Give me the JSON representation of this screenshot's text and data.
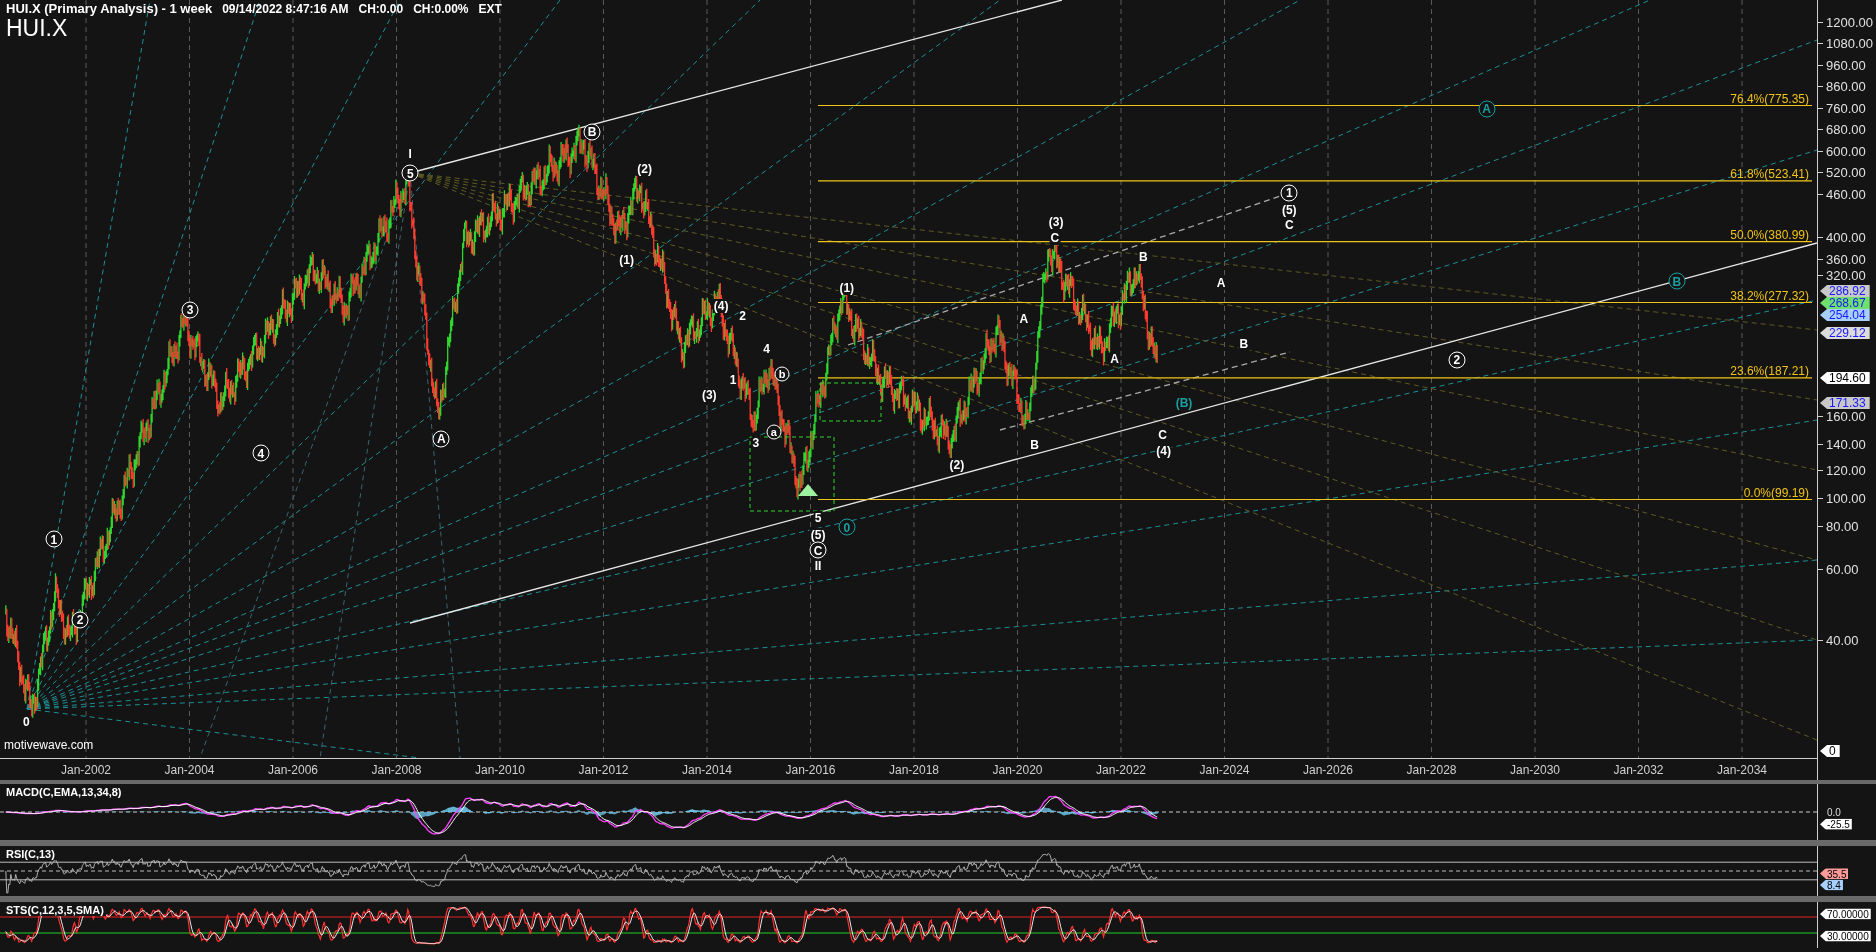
{
  "header": {
    "title": "HUI.X (Primary Analysis) - 1 week",
    "timestamp": "09/14/2022 8:47:16 AM",
    "change": "CH:0.00",
    "change_pct": "CH:0.00%",
    "session": "EXT",
    "symbol": "HUI.X"
  },
  "site_label": "motivewave.com",
  "price_axis": [
    "1200.00",
    "1080.00",
    "960.00",
    "860.00",
    "760.00",
    "680.00",
    "600.00",
    "520.00",
    "460.00",
    "400.00",
    "360.00",
    "320.00",
    "160.00",
    "140.00",
    "120.00",
    "100.00",
    "80.00",
    "60.00",
    "40.00"
  ],
  "price_tags": [
    {
      "text": "286.92",
      "color": "#c8c8c8",
      "kind": "study"
    },
    {
      "text": "268.67",
      "color": "#6ee06e",
      "kind": "study"
    },
    {
      "text": "254.04",
      "color": "#a8d0ff",
      "kind": "study"
    },
    {
      "text": "229.12",
      "color": "#dcdcdc",
      "kind": "study"
    },
    {
      "text": "194.60",
      "color": "#ffffff",
      "kind": "price"
    },
    {
      "text": "171.33",
      "color": "#c8c8c8",
      "kind": "study"
    },
    {
      "text": "0",
      "color": "#ffffff",
      "kind": "price"
    }
  ],
  "fib_levels": [
    "76.4%(775.35)",
    "61.8%(523.41)",
    "50.0%(380.99)",
    "38.2%(277.32)",
    "23.6%(187.21)",
    "0.0%(99.19)"
  ],
  "wave_labels": [
    {
      "text": "0",
      "kind": "plain",
      "color": "#ffffff"
    },
    {
      "text": "1",
      "kind": "circled",
      "color": "#ffffff"
    },
    {
      "text": "2",
      "kind": "circled",
      "color": "#ffffff"
    },
    {
      "text": "3",
      "kind": "circled",
      "color": "#ffffff"
    },
    {
      "text": "4",
      "kind": "circled",
      "color": "#ffffff"
    },
    {
      "text": "I",
      "kind": "plain",
      "color": "#ffffff"
    },
    {
      "text": "5",
      "kind": "circled",
      "color": "#ffffff"
    },
    {
      "text": "A",
      "kind": "circled",
      "color": "#ffffff"
    },
    {
      "text": "B",
      "kind": "circled",
      "color": "#ffffff"
    },
    {
      "text": "(2)",
      "kind": "plain",
      "color": "#ffffff"
    },
    {
      "text": "(1)",
      "kind": "plain",
      "color": "#ffffff"
    },
    {
      "text": "(4)",
      "kind": "plain",
      "color": "#ffffff"
    },
    {
      "text": "2",
      "kind": "plain",
      "color": "#ffffff"
    },
    {
      "text": "4",
      "kind": "plain",
      "color": "#ffffff"
    },
    {
      "text": "b",
      "kind": "small_circled",
      "color": "#ffffff"
    },
    {
      "text": "1",
      "kind": "plain",
      "color": "#ffffff"
    },
    {
      "text": "(3)",
      "kind": "plain",
      "color": "#ffffff"
    },
    {
      "text": "a",
      "kind": "small_circled",
      "color": "#ffffff"
    },
    {
      "text": "3",
      "kind": "plain",
      "color": "#ffffff"
    },
    {
      "text": "5",
      "kind": "plain",
      "color": "#ffffff"
    },
    {
      "text": "(5)",
      "kind": "plain",
      "color": "#ffffff"
    },
    {
      "text": "C",
      "kind": "circled",
      "color": "#ffffff"
    },
    {
      "text": "II",
      "kind": "plain",
      "color": "#ffffff"
    },
    {
      "text": "0",
      "kind": "circled",
      "color": "#1a9ea0"
    },
    {
      "text": "(1)",
      "kind": "plain",
      "color": "#ffffff"
    },
    {
      "text": "(2)",
      "kind": "plain",
      "color": "#ffffff"
    },
    {
      "text": "A",
      "kind": "plain",
      "color": "#ffffff"
    },
    {
      "text": "B",
      "kind": "plain",
      "color": "#ffffff"
    },
    {
      "text": "(3)",
      "kind": "plain",
      "color": "#ffffff"
    },
    {
      "text": "C",
      "kind": "plain",
      "color": "#ffffff"
    },
    {
      "text": "A",
      "kind": "plain",
      "color": "#ffffff"
    },
    {
      "text": "B",
      "kind": "plain",
      "color": "#ffffff"
    },
    {
      "text": "C",
      "kind": "plain",
      "color": "#ffffff"
    },
    {
      "text": "(4)",
      "kind": "plain",
      "color": "#ffffff"
    },
    {
      "text": "(B)",
      "kind": "plain",
      "color": "#1a9ea0"
    },
    {
      "text": "A",
      "kind": "plain",
      "color": "#ffffff"
    },
    {
      "text": "B",
      "kind": "plain",
      "color": "#ffffff"
    },
    {
      "text": "1",
      "kind": "circled",
      "color": "#ffffff"
    },
    {
      "text": "(5)",
      "kind": "plain",
      "color": "#ffffff"
    },
    {
      "text": "C",
      "kind": "plain",
      "color": "#ffffff"
    },
    {
      "text": "2",
      "kind": "circled",
      "color": "#ffffff"
    },
    {
      "text": "A",
      "kind": "circled",
      "color": "#1a9ea0"
    },
    {
      "text": "B",
      "kind": "circled",
      "color": "#1a9ea0"
    }
  ],
  "dates": [
    "Jan-2002",
    "Jan-2004",
    "Jan-2006",
    "Jan-2008",
    "Jan-2010",
    "Jan-2012",
    "Jan-2014",
    "Jan-2016",
    "Jan-2018",
    "Jan-2020",
    "Jan-2022",
    "Jan-2024",
    "Jan-2026",
    "Jan-2028",
    "Jan-2030",
    "Jan-2032",
    "Jan-2034"
  ],
  "indicators": [
    {
      "kind": "macd",
      "title": "MACD(C,EMA,13,34,8)",
      "tags": [
        {
          "text": "0.0",
          "color": "#141414"
        },
        {
          "text": "-25.5",
          "color": "#ffffff"
        }
      ]
    },
    {
      "kind": "rsi",
      "title": "RSI(C,13)",
      "tags": [
        {
          "text": "35.5",
          "color": "#ff9a9a"
        },
        {
          "text": "8.4",
          "color": "#a8d0ff"
        }
      ]
    },
    {
      "kind": "stoch",
      "title": "STS(C,12,3,5,SMA)",
      "tags": [
        {
          "text": "70.00000",
          "color": "#ffffff"
        },
        {
          "text": "30.00000",
          "color": "#ffffff"
        }
      ]
    }
  ]
}
